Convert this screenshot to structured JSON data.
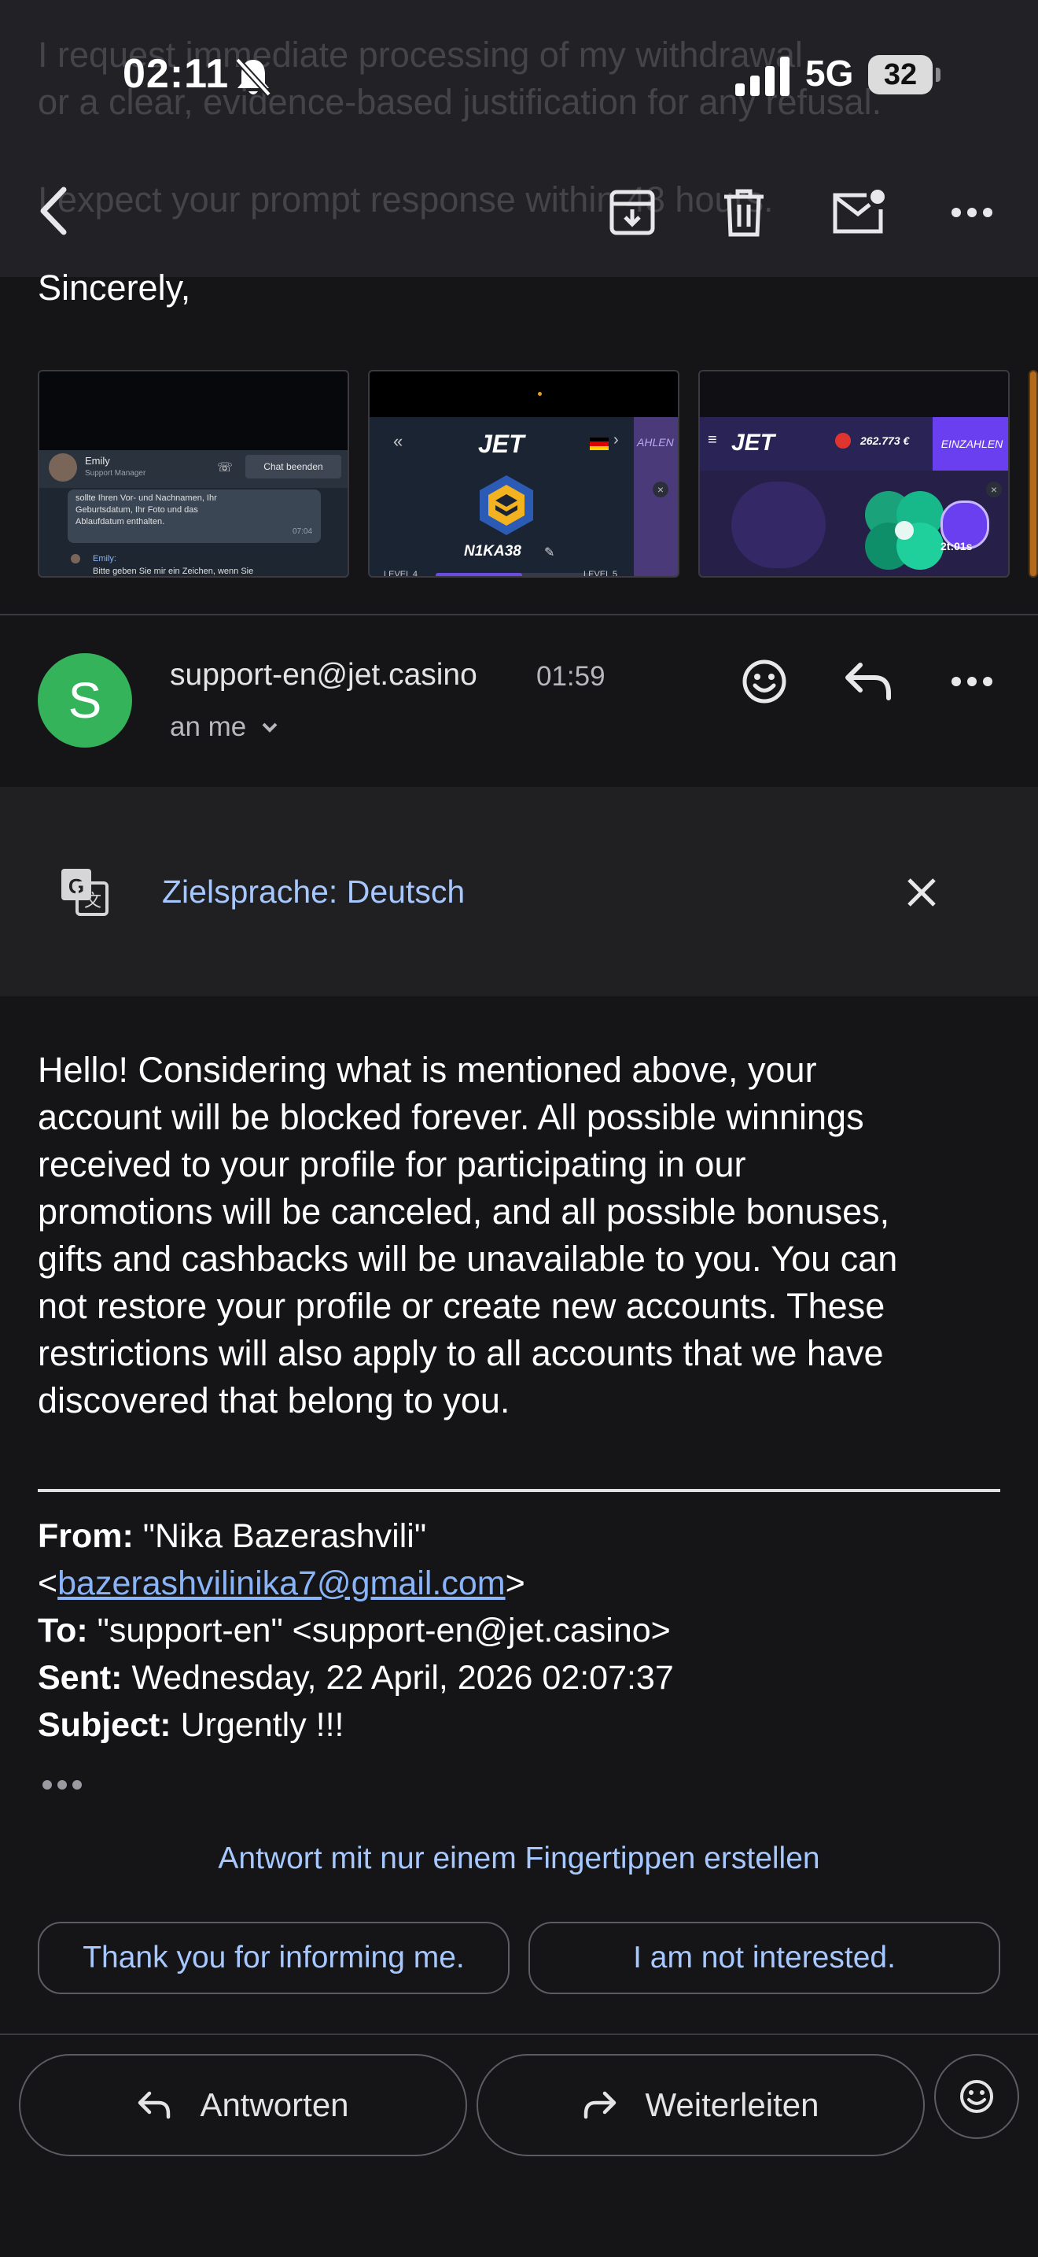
{
  "status_bar": {
    "time": "02:11",
    "network": "5G",
    "battery": "32"
  },
  "toolbar": {
    "icons": [
      "back-arrow-icon",
      "archive-icon",
      "trash-icon",
      "mark-unread-icon",
      "more-icon"
    ]
  },
  "previous_message": {
    "ghost_line_1": "I request immediate processing of my withdrawal",
    "ghost_line_2": "or a clear, evidence-based justification for any refusal.",
    "ghost_line_3": "I expect your prompt response within 48 hours.",
    "sincerely": "Sincerely,",
    "attachments": [
      {
        "agent_name": "Emily",
        "agent_role": "Support Manager",
        "end_chat": "Chat beenden",
        "chat_line_1": "sollte Ihren Vor- und Nachnamen, Ihr",
        "chat_line_2": "Geburtsdatum, Ihr Foto und das",
        "chat_line_3": "Ablaufdatum enthalten.",
        "chat_time": "07:04",
        "reply_name": "Emily:",
        "reply_line": "Bitte geben Sie mir ein Zeichen, wenn Sie"
      },
      {
        "brand": "JET",
        "username": "N1KA38",
        "level_left": "LEVEL 4",
        "level_right": "LEVEL 5",
        "side_label": "AHLEN"
      },
      {
        "brand": "JET",
        "balance": "262.773 €",
        "deposit": "EINZAHLEN",
        "timer": "2t:01s"
      }
    ]
  },
  "message": {
    "avatar_letter": "S",
    "sender": "support-en@jet.casino",
    "time": "01:59",
    "recipient": "an me",
    "icons": [
      "emoji-react-icon",
      "reply-icon",
      "more-icon"
    ]
  },
  "translation": {
    "label": "Zielsprache: Deutsch"
  },
  "body": {
    "lines": [
      "Hello! Considering what is mentioned above, your",
      "account will be blocked forever. All possible winnings",
      "received to your profile for participating in our",
      "promotions will be canceled, and all possible bonuses,",
      "gifts and cashbacks will be unavailable to you. You can",
      "not restore your profile or create new accounts. These",
      "restrictions will also apply to all accounts that we have",
      "discovered that belong to you."
    ]
  },
  "quoted_header": {
    "from_label": "From:",
    "from_name": "\"Nika Bazerashvili\"",
    "from_email": "bazerashvilinika7@gmail.com",
    "to_label": "To:",
    "to_value": "\"support-en\" <support-en@jet.casino>",
    "sent_label": "Sent:",
    "sent_value": "Wednesday, 22 April, 2026 02:07:37",
    "subject_label": "Subject:",
    "subject_value": "Urgently !!!"
  },
  "smart_reply": {
    "title": "Antwort mit nur einem Fingertippen erstellen",
    "chips": [
      "Thank you for informing me.",
      "I am not interested."
    ]
  },
  "actions": {
    "reply": "Antworten",
    "forward": "Weiterleiten"
  }
}
